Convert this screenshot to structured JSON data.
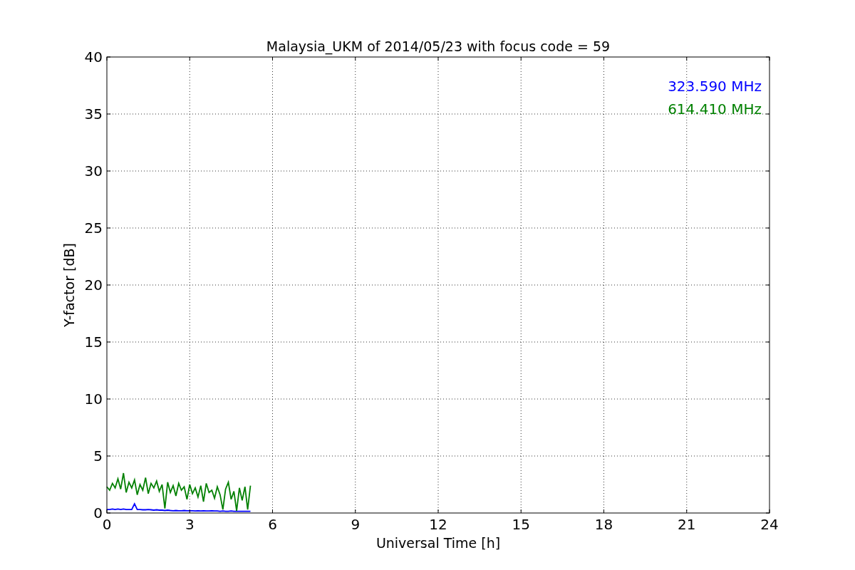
{
  "figure": {
    "chart_data": {
      "type": "line",
      "title": "Malaysia_UKM of 2014/05/23 with focus code = 59",
      "xlabel": "Universal Time [h]",
      "ylabel": "Y-factor [dB]",
      "x": [
        0,
        0.1,
        0.2,
        0.3,
        0.4,
        0.5,
        0.6,
        0.7,
        0.8,
        0.9,
        1.0,
        1.1,
        1.2,
        1.3,
        1.4,
        1.5,
        1.6,
        1.7,
        1.8,
        1.9,
        2.0,
        2.1,
        2.2,
        2.3,
        2.4,
        2.5,
        2.6,
        2.7,
        2.8,
        2.9,
        3.0,
        3.1,
        3.2,
        3.3,
        3.4,
        3.5,
        3.6,
        3.7,
        3.8,
        3.9,
        4.0,
        4.1,
        4.2,
        4.3,
        4.4,
        4.5,
        4.6,
        4.7,
        4.8,
        4.9,
        5.0,
        5.1,
        5.2
      ],
      "series": [
        {
          "name": "323.590 MHz",
          "color": "#0000ff",
          "values": [
            0.3,
            0.3,
            0.35,
            0.3,
            0.35,
            0.3,
            0.35,
            0.3,
            0.3,
            0.3,
            0.8,
            0.3,
            0.3,
            0.28,
            0.28,
            0.3,
            0.28,
            0.25,
            0.28,
            0.25,
            0.25,
            0.22,
            0.25,
            0.22,
            0.2,
            0.22,
            0.2,
            0.2,
            0.22,
            0.2,
            0.2,
            0.2,
            0.18,
            0.2,
            0.18,
            0.2,
            0.18,
            0.18,
            0.2,
            0.18,
            0.18,
            0.15,
            0.18,
            0.15,
            0.15,
            0.18,
            0.15,
            0.15,
            0.15,
            0.15,
            0.15,
            0.15,
            0.15
          ]
        },
        {
          "name": "614.410 MHz",
          "color": "#008000",
          "values": [
            2.3,
            2.0,
            2.6,
            2.2,
            3.0,
            2.1,
            3.5,
            1.8,
            2.7,
            2.2,
            2.9,
            1.6,
            2.5,
            2.0,
            3.1,
            1.7,
            2.6,
            2.2,
            2.8,
            1.9,
            2.5,
            0.4,
            2.7,
            1.8,
            2.4,
            1.5,
            2.6,
            2.0,
            2.3,
            1.2,
            2.5,
            1.7,
            2.2,
            1.4,
            2.4,
            1.0,
            2.6,
            1.8,
            2.0,
            1.3,
            2.3,
            1.6,
            0.3,
            2.1,
            2.7,
            1.2,
            1.9,
            0.2,
            2.2,
            1.1,
            2.3,
            0.3,
            2.4
          ]
        }
      ],
      "grid": true,
      "xlim": [
        0,
        24
      ],
      "ylim": [
        0,
        40
      ],
      "xticks": [
        0,
        3,
        6,
        9,
        12,
        15,
        18,
        21,
        24
      ],
      "yticks": [
        0,
        5,
        10,
        15,
        20,
        25,
        30,
        35,
        40
      ]
    }
  }
}
